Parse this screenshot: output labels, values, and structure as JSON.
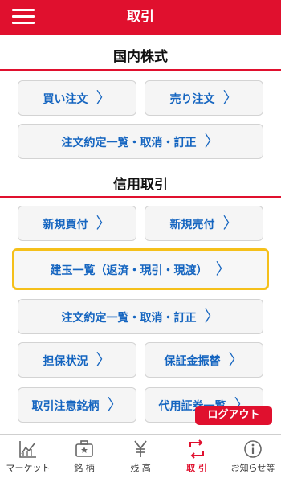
{
  "header": {
    "title": "取引"
  },
  "sections": {
    "domestic": {
      "title": "国内株式"
    },
    "margin": {
      "title": "信用取引"
    }
  },
  "buttons": {
    "buy_order": "買い注文",
    "sell_order": "売り注文",
    "order_list_domestic": "注文約定一覧・取消・訂正",
    "new_buy": "新規買付",
    "new_sell": "新規売付",
    "positions": "建玉一覧（返済・現引・現渡）",
    "order_list_margin": "注文約定一覧・取消・訂正",
    "collateral": "担保状況",
    "margin_transfer": "保証金振替",
    "trade_caution": "取引注意銘柄",
    "substitute": "代用証券一覧"
  },
  "chevron": "〉",
  "logout": "ログアウト",
  "tabbar": {
    "items": [
      {
        "label": "マーケット",
        "icon": "chart-icon"
      },
      {
        "label": "銘 柄",
        "icon": "briefcase-icon"
      },
      {
        "label": "残 高",
        "icon": "yen-icon"
      },
      {
        "label": "取 引",
        "icon": "exchange-icon",
        "active": true
      },
      {
        "label": "お知らせ等",
        "icon": "info-icon"
      }
    ]
  },
  "colors": {
    "brand": "#e0102e",
    "link": "#1565c0",
    "highlight": "#f5c01a"
  }
}
